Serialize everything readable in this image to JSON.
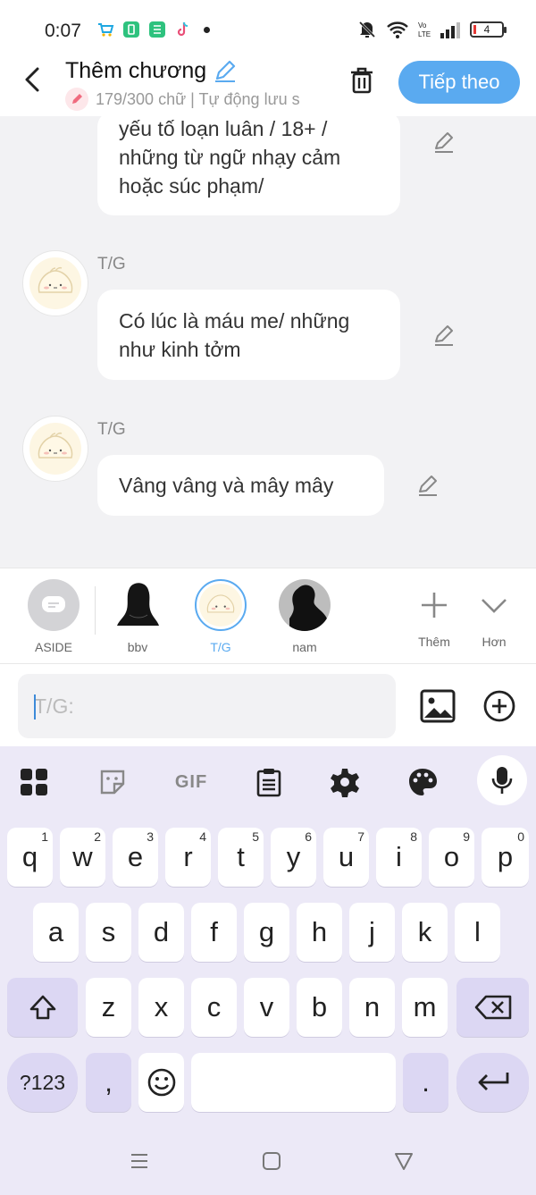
{
  "status_bar": {
    "time": "0:07",
    "battery": "4"
  },
  "header": {
    "title": "Thêm chương",
    "subtitle": "179/300 chữ | Tự động lưu s",
    "next_button": "Tiếp theo"
  },
  "messages": [
    {
      "sender": "",
      "text": "yếu tố loạn luân / 18+ / những từ ngữ nhạy cảm hoặc súc phạm/"
    },
    {
      "sender": "T/G",
      "text": "Có lúc là máu me/ những như kinh tởm"
    },
    {
      "sender": "T/G",
      "text": "Vâng vâng và mây mây"
    }
  ],
  "characters": [
    {
      "label": "ASIDE"
    },
    {
      "label": "bbv"
    },
    {
      "label": "T/G"
    },
    {
      "label": "nam"
    },
    {
      "label": "Thêm"
    },
    {
      "label": "Hơn"
    }
  ],
  "input": {
    "placeholder": "T/G:"
  },
  "keyboard": {
    "tools": [
      "apps-grid",
      "sticker",
      "GIF",
      "clipboard",
      "settings",
      "palette",
      "mic"
    ],
    "gif_label": "GIF",
    "row1": [
      {
        "k": "q",
        "n": "1"
      },
      {
        "k": "w",
        "n": "2"
      },
      {
        "k": "e",
        "n": "3"
      },
      {
        "k": "r",
        "n": "4"
      },
      {
        "k": "t",
        "n": "5"
      },
      {
        "k": "y",
        "n": "6"
      },
      {
        "k": "u",
        "n": "7"
      },
      {
        "k": "i",
        "n": "8"
      },
      {
        "k": "o",
        "n": "9"
      },
      {
        "k": "p",
        "n": "0"
      }
    ],
    "row2": [
      "a",
      "s",
      "d",
      "f",
      "g",
      "h",
      "j",
      "k",
      "l"
    ],
    "row3": [
      "z",
      "x",
      "c",
      "v",
      "b",
      "n",
      "m"
    ],
    "sym_label": "?123",
    "comma": ",",
    "period": "."
  },
  "colors": {
    "accent": "#5aaaf0",
    "chat_bg": "#f2f2f4",
    "keyboard_bg": "#ece9f7",
    "dark_key": "#dcd7f3"
  }
}
